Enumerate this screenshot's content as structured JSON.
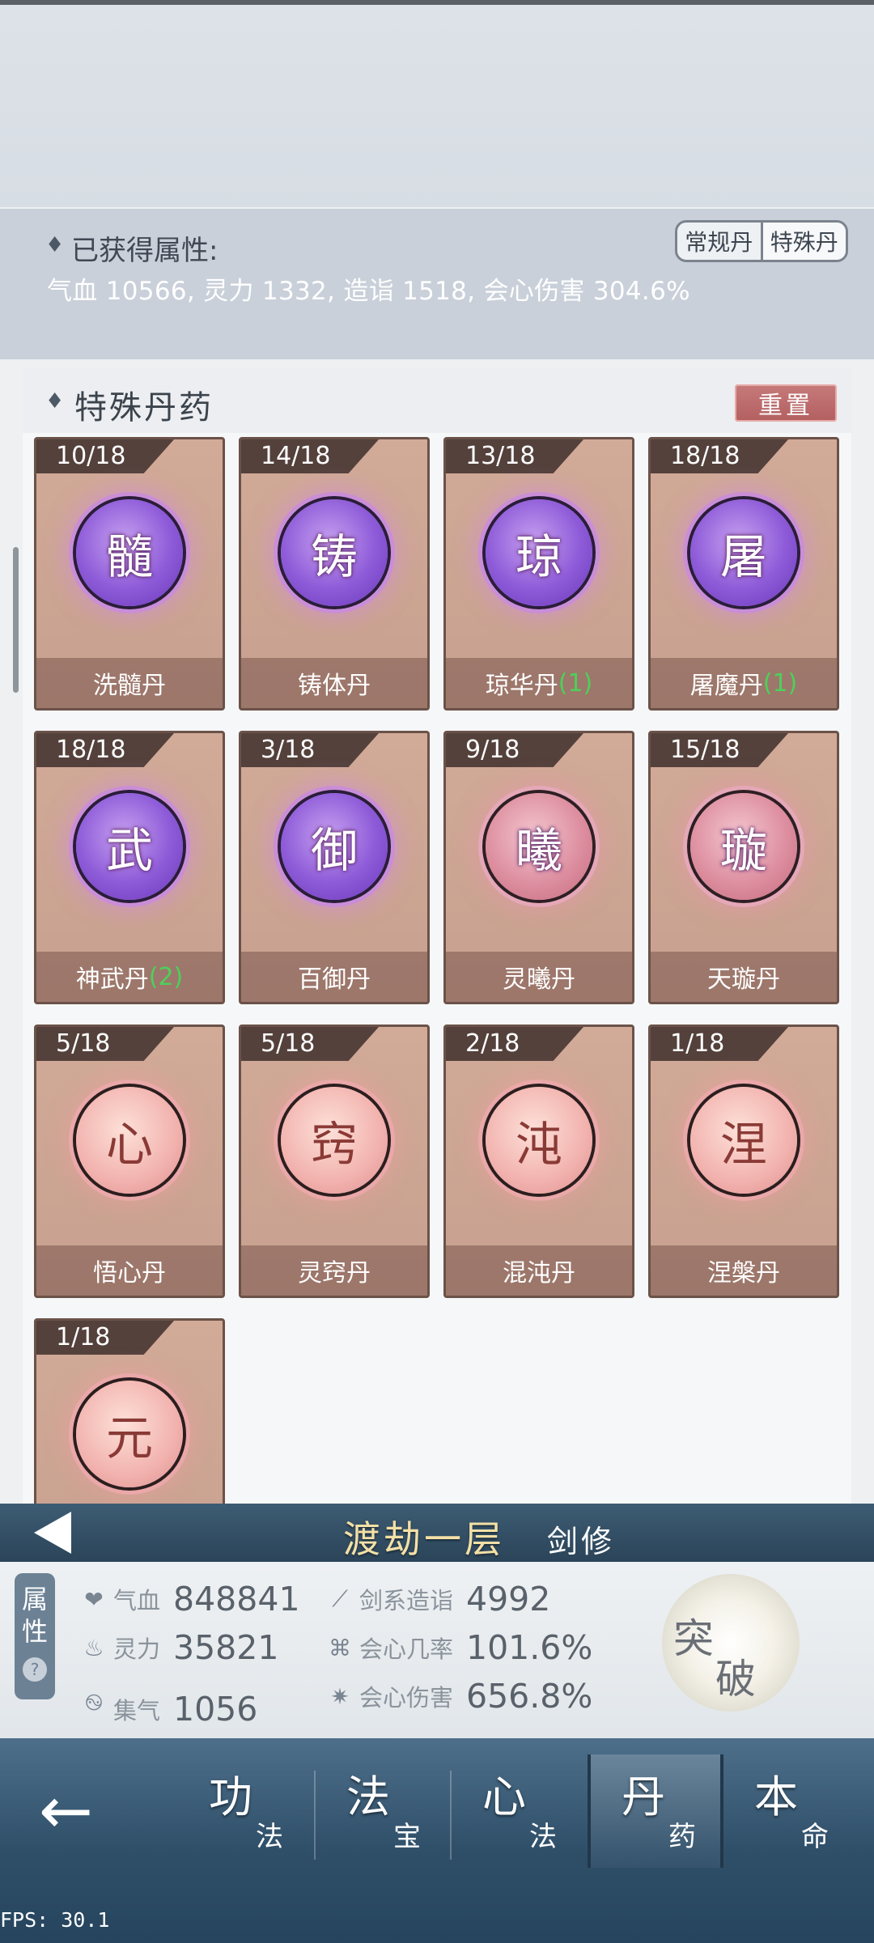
{
  "attributes": {
    "title": "已获得属性:",
    "values": "气血 10566, 灵力 1332, 造诣 1518, 会心伤害 304.6%"
  },
  "segment": {
    "regular": "常规丹",
    "special": "特殊丹"
  },
  "panel": {
    "title": "特殊丹药",
    "reset": "重置"
  },
  "pills": [
    {
      "progress": "10/18",
      "glyph": "髓",
      "name": "洗髓丹",
      "count": "",
      "style": "purple"
    },
    {
      "progress": "14/18",
      "glyph": "铸",
      "name": "铸体丹",
      "count": "",
      "style": "purple"
    },
    {
      "progress": "13/18",
      "glyph": "琼",
      "name": "琼华丹",
      "count": "(1)",
      "style": "purple"
    },
    {
      "progress": "18/18",
      "glyph": "屠",
      "name": "屠魔丹",
      "count": "(1)",
      "style": "purple"
    },
    {
      "progress": "18/18",
      "glyph": "武",
      "name": "神武丹",
      "count": "(2)",
      "style": "purple"
    },
    {
      "progress": "3/18",
      "glyph": "御",
      "name": "百御丹",
      "count": "",
      "style": "purple"
    },
    {
      "progress": "9/18",
      "glyph": "曦",
      "name": "灵曦丹",
      "count": "",
      "style": "pink"
    },
    {
      "progress": "15/18",
      "glyph": "璇",
      "name": "天璇丹",
      "count": "",
      "style": "pink"
    },
    {
      "progress": "5/18",
      "glyph": "心",
      "name": "悟心丹",
      "count": "",
      "style": "light"
    },
    {
      "progress": "5/18",
      "glyph": "窍",
      "name": "灵窍丹",
      "count": "",
      "style": "light"
    },
    {
      "progress": "2/18",
      "glyph": "沌",
      "name": "混沌丹",
      "count": "",
      "style": "light"
    },
    {
      "progress": "1/18",
      "glyph": "涅",
      "name": "涅槃丹",
      "count": "",
      "style": "light"
    },
    {
      "progress": "1/18",
      "glyph": "元",
      "name": "",
      "count": "",
      "style": "light"
    }
  ],
  "realm": {
    "name": "渡劫一层",
    "class": "剑修"
  },
  "stats_tab": {
    "line1": "属",
    "line2": "性",
    "help": "?"
  },
  "stats": {
    "hp": {
      "label": "气血",
      "value": "848841",
      "icon": "heart-icon"
    },
    "sword": {
      "label": "剑系造诣",
      "value": "4992",
      "icon": "sword-icon"
    },
    "mana": {
      "label": "灵力",
      "value": "35821",
      "icon": "flame-icon"
    },
    "crit_rate": {
      "label": "会心几率",
      "value": "101.6%",
      "icon": "crit-rate-icon"
    },
    "gather": {
      "label": "集气",
      "value": "1056",
      "icon": "swirl-icon"
    },
    "crit_dmg": {
      "label": "会心伤害",
      "value": "656.8%",
      "icon": "burst-icon"
    }
  },
  "breakthrough": {
    "char1": "突",
    "char2": "破"
  },
  "nav": [
    {
      "big": "功",
      "small": "法"
    },
    {
      "big": "法",
      "small": "宝"
    },
    {
      "big": "心",
      "small": "法"
    },
    {
      "big": "丹",
      "small": "药"
    },
    {
      "big": "本",
      "small": "命"
    }
  ],
  "fps": "FPS: 30.1"
}
